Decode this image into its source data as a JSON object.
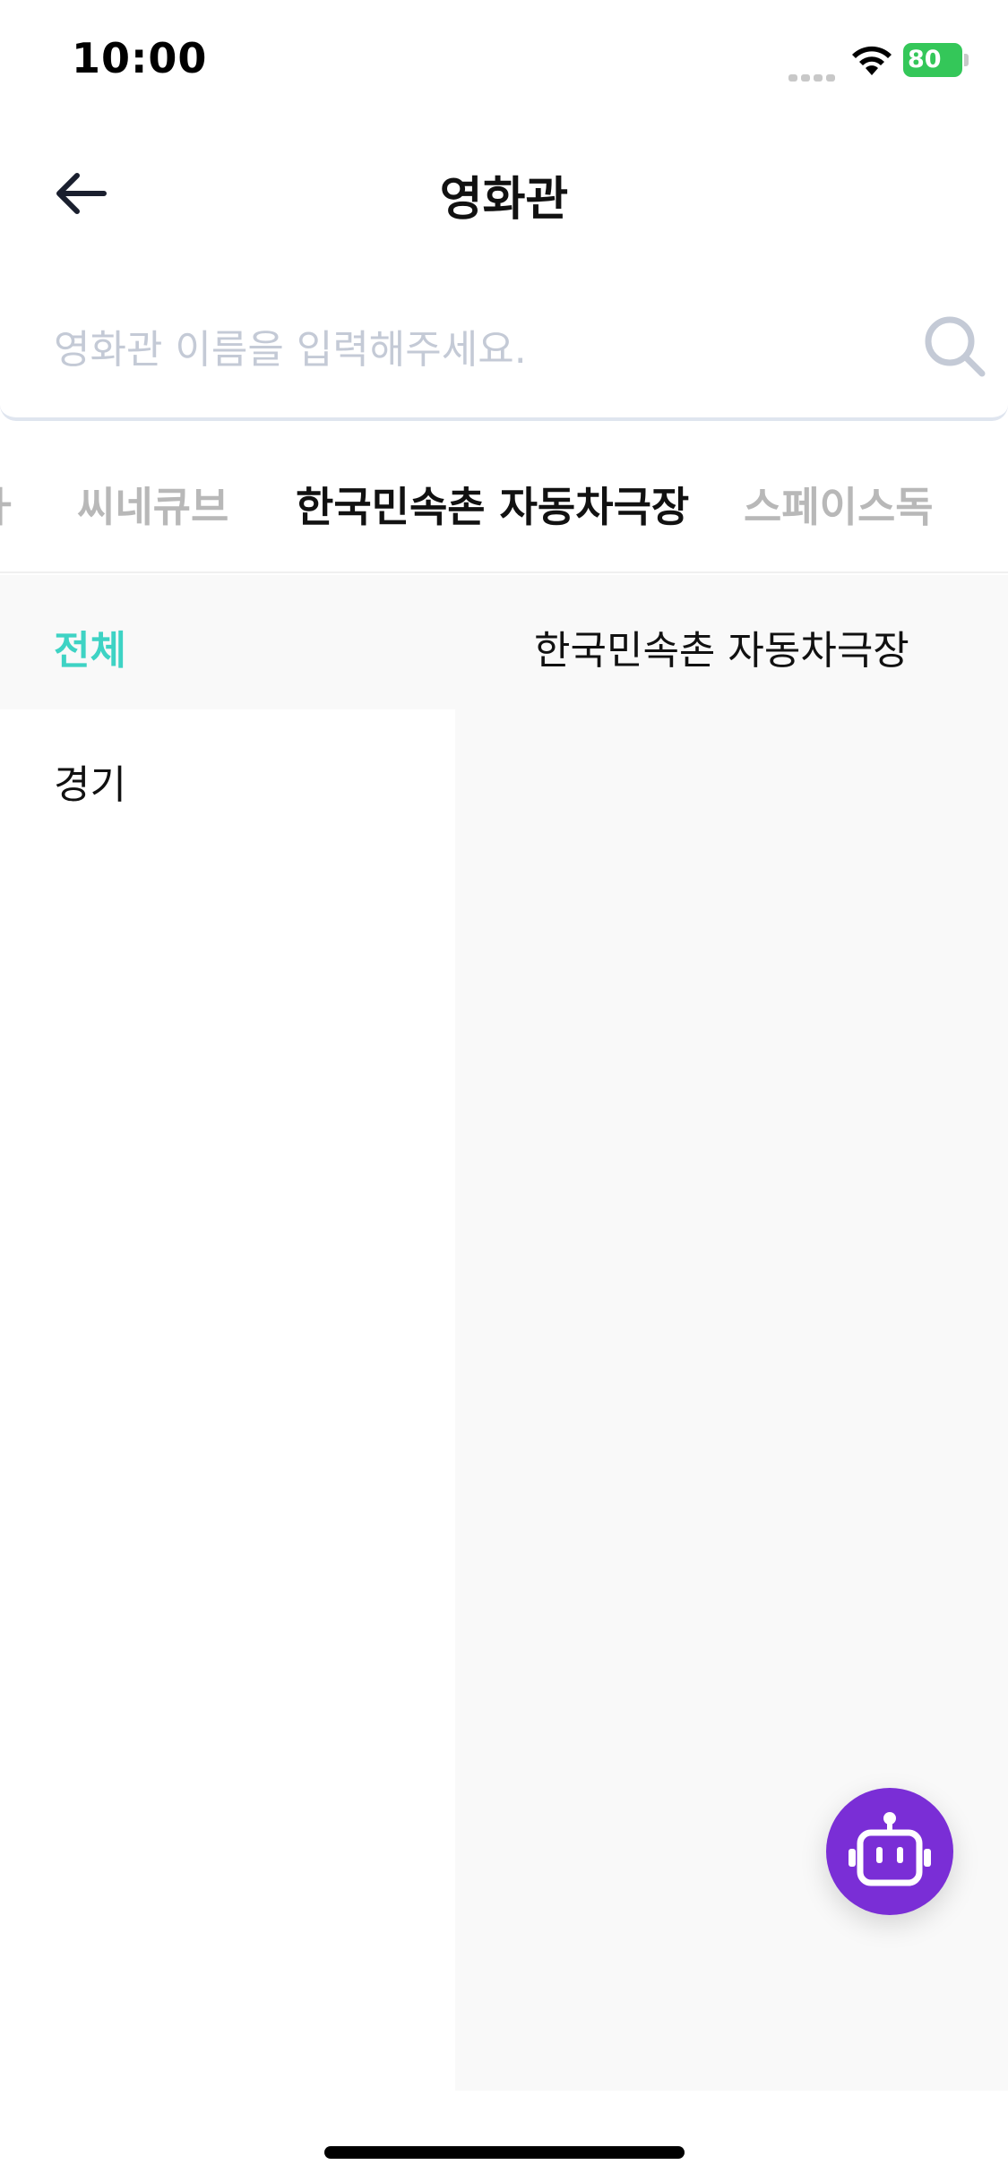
{
  "status_bar": {
    "time": "10:00",
    "battery_level": "80"
  },
  "header": {
    "title": "영화관"
  },
  "search": {
    "placeholder": "영화관 이름을 입력해주세요."
  },
  "tabs": [
    {
      "label": "씨네큐브",
      "active": false
    },
    {
      "label": "한국민속촌 자동차극장",
      "active": true
    },
    {
      "label": "스페이스독",
      "active": false
    }
  ],
  "regions": {
    "all_label": "전체",
    "items": [
      {
        "label": "경기"
      }
    ]
  },
  "theaters": [
    {
      "label": "한국민속촌 자동차극장"
    }
  ],
  "colors": {
    "accent": "#3ed3c4",
    "fab": "#7a2ed6",
    "battery": "#34c759"
  },
  "icons": {
    "back": "back-arrow-icon",
    "search": "search-icon",
    "chatbot": "robot-icon"
  }
}
